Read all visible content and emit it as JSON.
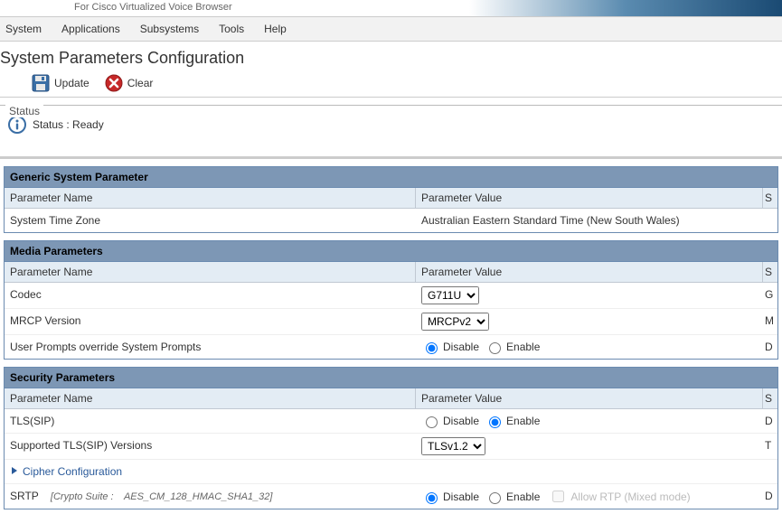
{
  "header": {
    "subtitle": "For Cisco Virtualized Voice Browser"
  },
  "menubar": [
    "System",
    "Applications",
    "Subsystems",
    "Tools",
    "Help"
  ],
  "page_title": "System Parameters Configuration",
  "toolbar": {
    "update_label": "Update",
    "clear_label": "Clear"
  },
  "status": {
    "legend": "Status",
    "text": "Status : Ready"
  },
  "columns": {
    "name": "Parameter Name",
    "value": "Parameter Value",
    "suggested": "S"
  },
  "sections": {
    "generic": {
      "title": "Generic System Parameter",
      "rows": {
        "timezone": {
          "name": "System Time Zone",
          "value": "Australian Eastern Standard Time (New South Wales)"
        }
      }
    },
    "media": {
      "title": "Media Parameters",
      "rows": {
        "codec": {
          "name": "Codec",
          "value": "G711U",
          "suggested": "G"
        },
        "mrcp": {
          "name": "MRCP Version",
          "value": "MRCPv2",
          "suggested": "M"
        },
        "user_prompts": {
          "name": "User Prompts override System Prompts",
          "options": {
            "disable": "Disable",
            "enable": "Enable"
          },
          "selected": "disable",
          "suggested": "D"
        }
      }
    },
    "security": {
      "title": "Security Parameters",
      "rows": {
        "tls_sip": {
          "name": "TLS(SIP)",
          "options": {
            "disable": "Disable",
            "enable": "Enable"
          },
          "selected": "enable",
          "suggested": "D"
        },
        "tls_versions": {
          "name": "Supported TLS(SIP) Versions",
          "value": "TLSv1.2",
          "suggested": "T"
        },
        "cipher": {
          "name": "Cipher Configuration"
        },
        "srtp": {
          "name": "SRTP",
          "crypto_label": "[Crypto Suite :",
          "crypto_value": "AES_CM_128_HMAC_SHA1_32]",
          "options": {
            "disable": "Disable",
            "enable": "Enable"
          },
          "selected": "disable",
          "allow_rtp": "Allow RTP (Mixed mode)",
          "suggested": "D"
        }
      }
    }
  }
}
